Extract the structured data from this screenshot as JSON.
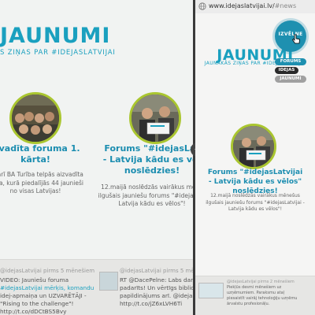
{
  "left_page": {
    "title": "JAUNUMI",
    "subtitle": "S ZIŅAS PAR #IDEJASLATVIJAI",
    "articles": [
      {
        "title_lines": [
          "izvadīta foruma 1.",
          "kārta!"
        ],
        "text_lines": [
          "bruārī BA Turība telpās aizvadīta",
          "kārta, kurā piedalījās 44 jaunieši",
          "no visas Latvijas!"
        ]
      },
      {
        "title_lines": [
          "Forums \"#idejasLat",
          "- Latvija kādu es vēl",
          "noslēdzies!"
        ],
        "text_lines": [
          "12.maijā noslēdzās vairākus mēne",
          "ilgušais jauniešu forums \"#idejasLat",
          "Latvija kādu es vēlos\"!"
        ]
      }
    ],
    "tweets": [
      {
        "meta": "@idejasLatvijai pirms 5 mēnešiem",
        "lines": [
          "VIDEO: Jauniešu foruma",
          "#idejasLatvijai mērķis, komandu",
          "idej-apmaiņa un UZVARĒTĀJI -",
          "\"Rising to the challenge\"!",
          "http://t.co/dDCtBS5Bvy"
        ]
      },
      {
        "meta": "@idejasLatvijai pirms 5 mēneš",
        "lines": [
          "RT @DacePelne: Labs dar",
          "padarīts! Un vērtīgs biblio",
          "papildinājums arī. @idejasL",
          "http://t.co/jZ6xLVH6Ti"
        ]
      }
    ]
  },
  "mobile": {
    "url_host": "www.idejaslatvijai.lv/",
    "url_hash": "#news",
    "menu_label": "IZVĒLNE",
    "menu_items": [
      "FORUMS",
      "IDEJAS",
      "JAUNUMI"
    ],
    "title": "JAUNUMI",
    "subtitle": "JAUNĀKĀS ZIŅAS PAR #IDEJASLATVIJAI",
    "article": {
      "title_lines": [
        "Forums \"#idejasLatvijai",
        "- Latvija kādu es vēlos\"",
        "noslēdzies!"
      ],
      "text_lines": [
        "12.maijā noslēdzās vairākus mēnešus",
        "ilgušais jauniešu forums \"#idejasLatvijai -",
        "Latvija kādu es vēlos\"!"
      ]
    },
    "tweet": {
      "meta": "@idejasLatvijai pirms 2 mēnešiem",
      "lines": [
        "Piekļūs desmi mēnešiem uz",
        "uzņēmumiem. Paraksmu ataļ",
        "piesaistīt vairāj tehnoloģiju uzņēmu",
        "ārvalstu profesionāļu."
      ]
    }
  },
  "colors": {
    "accent": "#1aa0bf",
    "lime_ring": "#aac630",
    "menu_blue": "#1e90b0",
    "page_bg": "#f1f3f2"
  }
}
